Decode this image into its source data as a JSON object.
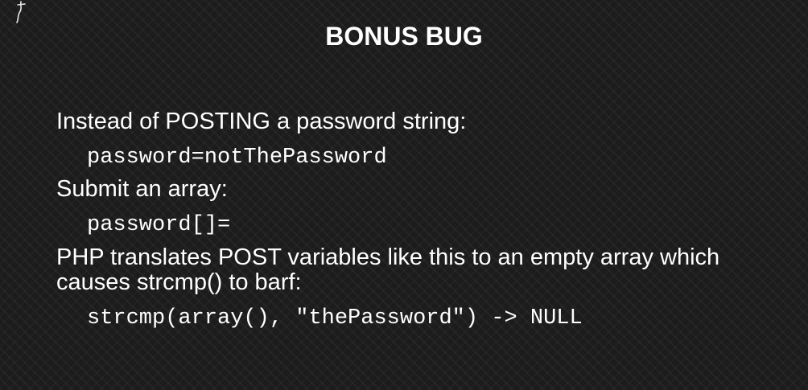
{
  "slide": {
    "title": "BONUS BUG",
    "line1": "Instead of POSTING a password string:",
    "code1": "password=notThePassword",
    "line2": "Submit an array:",
    "code2": "password[]=",
    "line3": "PHP translates POST variables like this to an empty array which causes strcmp() to barf:",
    "code3": "strcmp(array(), \"thePassword\") -> NULL"
  },
  "colors": {
    "background": "#1c1c1c",
    "text": "#ffffff"
  }
}
